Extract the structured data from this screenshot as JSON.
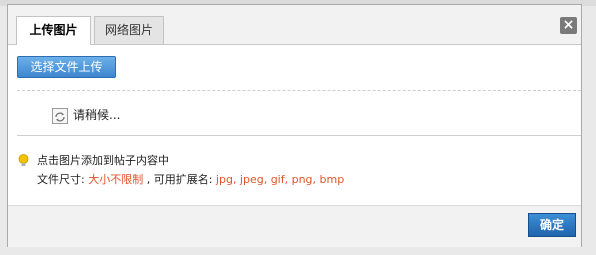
{
  "dialog": {
    "tabs": [
      {
        "label": "上传图片",
        "active": true
      },
      {
        "label": "网络图片",
        "active": false
      }
    ],
    "close_label": "×",
    "upload_button_label": "选择文件上传",
    "loading_text": "请稍候...",
    "hint_text": "点击图片添加到帖子内容中",
    "size_label": "文件尺寸: ",
    "size_value": "大小不限制",
    "ext_label": " , 可用扩展名: ",
    "ext_value": "jpg, jpeg, gif, png, bmp",
    "ok_label": "确定"
  },
  "icons": {
    "close": "close-icon",
    "loading": "refresh-icon",
    "hint": "lightbulb-icon"
  },
  "colors": {
    "accent": "#3e86cf",
    "highlight": "#e0532b"
  }
}
